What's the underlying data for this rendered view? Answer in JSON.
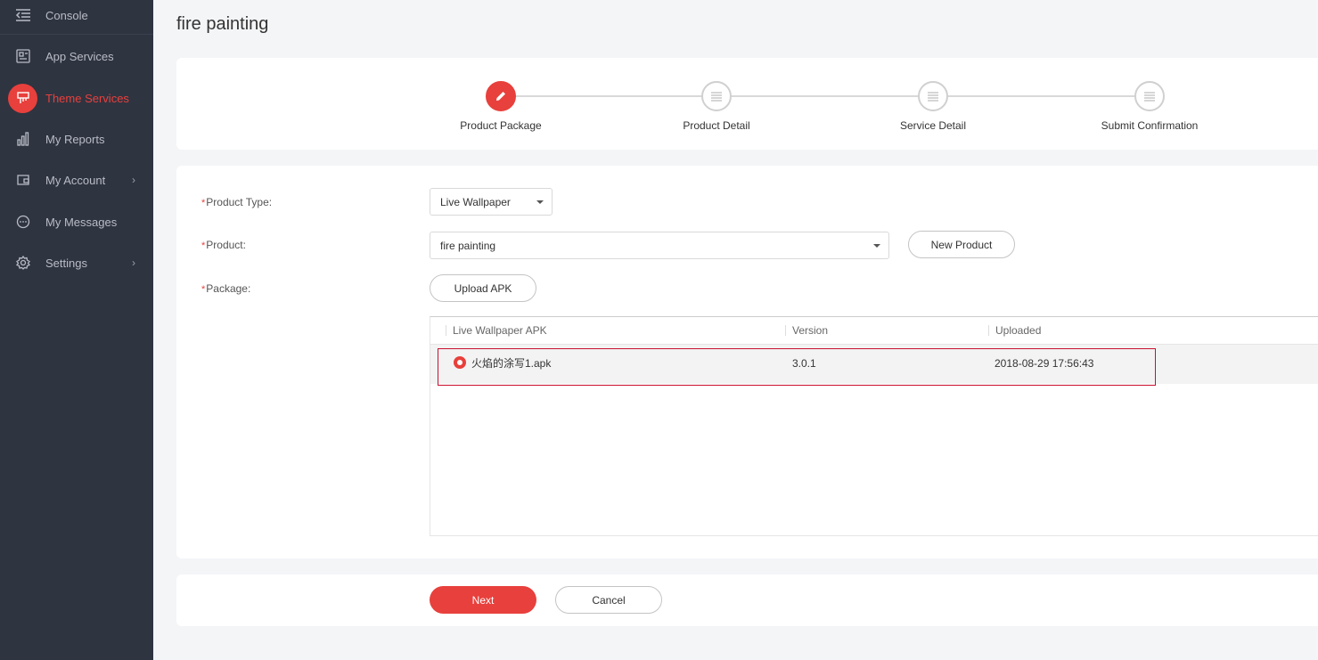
{
  "sidebar": {
    "items": [
      {
        "label": "Console",
        "icon": "console-icon"
      },
      {
        "label": "App Services",
        "icon": "app-services-icon"
      },
      {
        "label": "Theme Services",
        "icon": "theme-services-icon",
        "active": true
      },
      {
        "label": "My Reports",
        "icon": "bar-chart-icon"
      },
      {
        "label": "My Account",
        "icon": "account-icon",
        "chevron": "›"
      },
      {
        "label": "My Messages",
        "icon": "message-icon"
      },
      {
        "label": "Settings",
        "icon": "gear-icon",
        "chevron": "›"
      }
    ]
  },
  "page": {
    "title": "fire painting"
  },
  "steps": [
    {
      "label": "Product Package",
      "active": true
    },
    {
      "label": "Product Detail"
    },
    {
      "label": "Service Detail"
    },
    {
      "label": "Submit Confirmation"
    }
  ],
  "form": {
    "required_mark": "*",
    "product_type": {
      "label": "Product Type:",
      "value": "Live Wallpaper"
    },
    "product": {
      "label": "Product:",
      "value": "fire painting",
      "new_button": "New Product"
    },
    "package": {
      "label": "Package:",
      "upload_button": "Upload APK"
    }
  },
  "table": {
    "columns": [
      "Live Wallpaper APK",
      "Version",
      "Uploaded"
    ],
    "rows": [
      {
        "name": "火焰的涂写1.apk",
        "version": "3.0.1",
        "uploaded": "2018-08-29 17:56:43",
        "selected": true
      }
    ]
  },
  "footer": {
    "next_label": "Next",
    "cancel_label": "Cancel"
  },
  "colors": {
    "accent": "#e8403c",
    "sidebar_bg": "#2f3441",
    "page_bg": "#f4f5f7"
  }
}
